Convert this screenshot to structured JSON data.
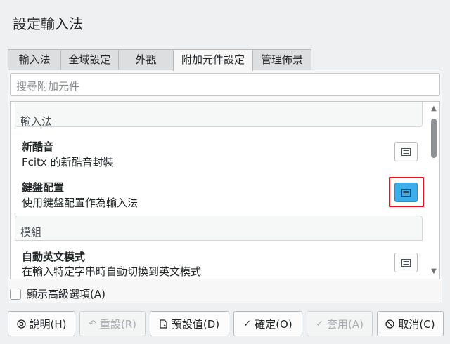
{
  "window": {
    "title": "設定輸入法"
  },
  "tabs": [
    {
      "label": "輸入法"
    },
    {
      "label": "全域設定"
    },
    {
      "label": "外觀"
    },
    {
      "label": "附加元件設定"
    },
    {
      "label": "管理佈景"
    }
  ],
  "search": {
    "placeholder": "搜尋附加元件"
  },
  "sections": [
    {
      "label": "輸入法",
      "items": [
        {
          "name": "新酷音",
          "description": "Fcitx 的新酷音封裝"
        },
        {
          "name": "鍵盤配置",
          "description": "使用鍵盤配置作為輸入法"
        }
      ]
    },
    {
      "label": "模組",
      "items": [
        {
          "name": "自動英文模式",
          "description": "在輸入特定字串時自動切換到英文模式"
        }
      ]
    }
  ],
  "advanced_option": {
    "label": "顯示高級選項(A)",
    "checked": false
  },
  "buttons": {
    "help": "說明(H)",
    "reset": "重設(R)",
    "defaults": "預設值(D)",
    "ok": "確定(O)",
    "apply": "套用(A)",
    "cancel": "取消(C)"
  },
  "colors": {
    "accent": "#3daee9",
    "highlight_box": "#e8141b",
    "background": "#eff0f1"
  }
}
